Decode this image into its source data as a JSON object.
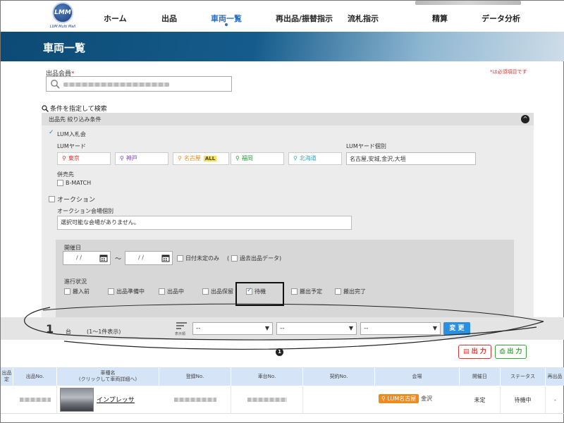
{
  "app": {
    "logo_text": "LMM",
    "logo_subtitle": "LUM Multi Mall"
  },
  "nav": {
    "items": [
      {
        "label": "ホーム"
      },
      {
        "label": "出品"
      },
      {
        "label": "車両一覧"
      },
      {
        "label": "再出品/振替指示"
      },
      {
        "label": "流札指示"
      },
      {
        "label": "精算"
      },
      {
        "label": "データ分析"
      }
    ],
    "active_index": 2
  },
  "page": {
    "title": "車両一覧"
  },
  "seller": {
    "label": "出品会員",
    "required_mark": "*",
    "required_note": "*は必須項目です"
  },
  "conditions": {
    "title": "条件を指定して検索",
    "panel_header": "出品先 絞り込み条件",
    "collapse_icon": "^",
    "lum_auction": {
      "label": "LUM入札会",
      "checked": true
    },
    "yard": {
      "label": "LUMヤード",
      "items": [
        {
          "label": "東京",
          "color": "#e0302b"
        },
        {
          "label": "神戸",
          "color": "#7b3fb5"
        },
        {
          "label": "名古屋",
          "color": "#f08a1c",
          "badge": "ALL"
        },
        {
          "label": "福岡",
          "color": "#2a9d3a"
        },
        {
          "label": "北海道",
          "color": "#2aa6c9"
        }
      ]
    },
    "yard_individual": {
      "label": "LUMヤード個別",
      "value": "名古屋,安城,金沢,大垣"
    },
    "concurrent": {
      "label": "併売先",
      "option": "B-MATCH",
      "checked": false
    },
    "auction": {
      "label": "オークション",
      "checked": false
    },
    "auction_venue": {
      "label": "オークション会場個別",
      "value": "選択可能な会場がありません。"
    },
    "date": {
      "label": "開催日",
      "from_placeholder": "/ /",
      "to_placeholder": "/ /",
      "separator": "〜",
      "undecided": "日付未定のみ",
      "past_open": "(",
      "past": "過去出品データ",
      "past_close": ")"
    },
    "status": {
      "label": "進行状況",
      "options": [
        {
          "label": "搬入前",
          "checked": false
        },
        {
          "label": "出品準備中",
          "checked": false
        },
        {
          "label": "出品中",
          "checked": false
        },
        {
          "label": "出品保留",
          "checked": false
        },
        {
          "label": "待機",
          "checked": true
        },
        {
          "label": "搬出予定",
          "checked": false
        },
        {
          "label": "搬出完了",
          "checked": false
        }
      ]
    }
  },
  "results": {
    "count": "1",
    "unit": "台",
    "range": "(1〜1件表示)",
    "sort_label": "表示順",
    "selects": [
      "--",
      "--",
      "--"
    ],
    "change_button": "変 更",
    "info_icon": "1",
    "export_pdf": "出 力",
    "export_xls": "出 力"
  },
  "table": {
    "headers": [
      "出品\n定",
      "出品No.",
      "車種名\n(クリックして車両詳細へ)",
      "登録No.",
      "車台No.",
      "契約No.",
      "会場",
      "開催日",
      "ステータス",
      "再出品"
    ],
    "rows": [
      {
        "car_name": "インプレッサ",
        "venue_badge": "LUM名古屋",
        "venue_city": "金沢",
        "date": "未定",
        "status": "待機中",
        "last": "-"
      }
    ]
  }
}
